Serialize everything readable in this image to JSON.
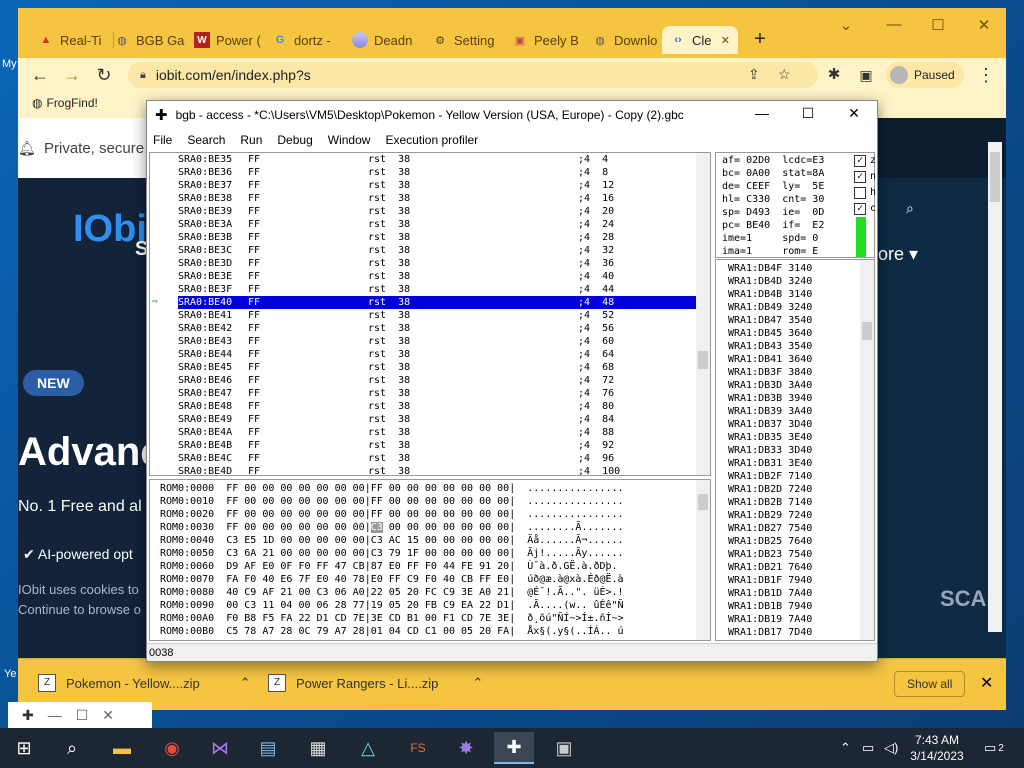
{
  "desktop": {
    "label_my": "My",
    "label_ye": "Ye"
  },
  "chrome": {
    "tabs": [
      {
        "label": "Real-Ti",
        "icon": "warning-icon",
        "color": "#d9302a"
      },
      {
        "label": "BGB Ga",
        "icon": "globe-icon",
        "color": "#555555"
      },
      {
        "label": "Power (",
        "icon": "w-logo-icon",
        "color": "#b52020"
      },
      {
        "label": "dortz -",
        "icon": "google-icon",
        "color": "#4285f4"
      },
      {
        "label": "Deadn",
        "icon": "stripes-icon",
        "color": "#8a8ad8"
      },
      {
        "label": "Setting",
        "icon": "gear-icon",
        "color": "#222222"
      },
      {
        "label": "Peely B",
        "icon": "image-icon",
        "color": "#c44"
      },
      {
        "label": "Downlo",
        "icon": "globe-icon",
        "color": "#555555"
      },
      {
        "label": "Cle",
        "icon": "code-icon",
        "color": "#1a6ed8"
      }
    ],
    "url": "iobit.com/en/index.php?s",
    "profile_label": "Paused",
    "bookmark": "FrogFind!"
  },
  "page": {
    "notif_text": "Private, secure",
    "brand": "IObi",
    "brand_s": "S",
    "new_badge": "NEW",
    "headline": "Advance",
    "sub": "No. 1 Free and al",
    "ai": "AI-powered opt",
    "cookie1": "IObit uses cookies to",
    "cookie2": "Continue to browse o",
    "store": "tore",
    "scan": "SCAN"
  },
  "downloads": {
    "items": [
      "Pokemon - Yellow....zip",
      "Power Rangers - Li....zip"
    ],
    "show_all": "Show all"
  },
  "bgb": {
    "title": "bgb - access - *C:\\Users\\VM5\\Desktop\\Pokemon - Yellow Version (USA, Europe) - Copy (2).gbc",
    "menu": [
      "File",
      "Search",
      "Run",
      "Debug",
      "Window",
      "Execution profiler"
    ],
    "disasm": [
      {
        "addr": "SRA0:BE35",
        "b": "FF",
        "op": "rst  38",
        "c": ";4  4"
      },
      {
        "addr": "SRA0:BE36",
        "b": "FF",
        "op": "rst  38",
        "c": ";4  8"
      },
      {
        "addr": "SRA0:BE37",
        "b": "FF",
        "op": "rst  38",
        "c": ";4  12"
      },
      {
        "addr": "SRA0:BE38",
        "b": "FF",
        "op": "rst  38",
        "c": ";4  16"
      },
      {
        "addr": "SRA0:BE39",
        "b": "FF",
        "op": "rst  38",
        "c": ";4  20"
      },
      {
        "addr": "SRA0:BE3A",
        "b": "FF",
        "op": "rst  38",
        "c": ";4  24"
      },
      {
        "addr": "SRA0:BE3B",
        "b": "FF",
        "op": "rst  38",
        "c": ";4  28"
      },
      {
        "addr": "SRA0:BE3C",
        "b": "FF",
        "op": "rst  38",
        "c": ";4  32"
      },
      {
        "addr": "SRA0:BE3D",
        "b": "FF",
        "op": "rst  38",
        "c": ";4  36"
      },
      {
        "addr": "SRA0:BE3E",
        "b": "FF",
        "op": "rst  38",
        "c": ";4  40"
      },
      {
        "addr": "SRA0:BE3F",
        "b": "FF",
        "op": "rst  38",
        "c": ";4  44"
      },
      {
        "addr": "SRA0:BE40",
        "b": "FF",
        "op": "rst  38",
        "c": ";4  48",
        "sel": true
      },
      {
        "addr": "SRA0:BE41",
        "b": "FF",
        "op": "rst  38",
        "c": ";4  52"
      },
      {
        "addr": "SRA0:BE42",
        "b": "FF",
        "op": "rst  38",
        "c": ";4  56"
      },
      {
        "addr": "SRA0:BE43",
        "b": "FF",
        "op": "rst  38",
        "c": ";4  60"
      },
      {
        "addr": "SRA0:BE44",
        "b": "FF",
        "op": "rst  38",
        "c": ";4  64"
      },
      {
        "addr": "SRA0:BE45",
        "b": "FF",
        "op": "rst  38",
        "c": ";4  68"
      },
      {
        "addr": "SRA0:BE46",
        "b": "FF",
        "op": "rst  38",
        "c": ";4  72"
      },
      {
        "addr": "SRA0:BE47",
        "b": "FF",
        "op": "rst  38",
        "c": ";4  76"
      },
      {
        "addr": "SRA0:BE48",
        "b": "FF",
        "op": "rst  38",
        "c": ";4  80"
      },
      {
        "addr": "SRA0:BE49",
        "b": "FF",
        "op": "rst  38",
        "c": ";4  84"
      },
      {
        "addr": "SRA0:BE4A",
        "b": "FF",
        "op": "rst  38",
        "c": ";4  88"
      },
      {
        "addr": "SRA0:BE4B",
        "b": "FF",
        "op": "rst  38",
        "c": ";4  92"
      },
      {
        "addr": "SRA0:BE4C",
        "b": "FF",
        "op": "rst  38",
        "c": ";4  96"
      },
      {
        "addr": "SRA0:BE4D",
        "b": "FF",
        "op": "rst  38",
        "c": ";4  100"
      }
    ],
    "regs": [
      "af= 02D0  lcdc=E3",
      "bc= 0A00  stat=8A",
      "de= CEEF  ly=  5E",
      "hl= C330  cnt= 30",
      "sp= D493  ie=  0D",
      "pc= BE40  if=  E2",
      "ime=1     spd= 0",
      "ima=1     rom= E"
    ],
    "flags": [
      {
        "label": "z",
        "checked": true
      },
      {
        "label": "n",
        "checked": true
      },
      {
        "label": "h",
        "checked": false
      },
      {
        "label": "c",
        "checked": true
      }
    ],
    "stack": [
      "WRA1:DB4F 3140",
      "WRA1:DB4D 3240",
      "WRA1:DB4B 3140",
      "WRA1:DB49 3240",
      "WRA1:DB47 3540",
      "WRA1:DB45 3640",
      "WRA1:DB43 3540",
      "WRA1:DB41 3640",
      "WRA1:DB3F 3840",
      "WRA1:DB3D 3A40",
      "WRA1:DB3B 3940",
      "WRA1:DB39 3A40",
      "WRA1:DB37 3D40",
      "WRA1:DB35 3E40",
      "WRA1:DB33 3D40",
      "WRA1:DB31 3E40",
      "WRA1:DB2F 7140",
      "WRA1:DB2D 7240",
      "WRA1:DB2B 7140",
      "WRA1:DB29 7240",
      "WRA1:DB27 7540",
      "WRA1:DB25 7640",
      "WRA1:DB23 7540",
      "WRA1:DB21 7640",
      "WRA1:DB1F 7940",
      "WRA1:DB1D 7A40",
      "WRA1:DB1B 7940",
      "WRA1:DB19 7A40",
      "WRA1:DB17 7D40"
    ],
    "hex": [
      "ROM0:0000  FF 00 00 00 00 00 00 00|FF 00 00 00 00 00 00 00|  ................",
      "ROM0:0010  FF 00 00 00 00 00 00 00|FF 00 00 00 00 00 00 00|  ................",
      "ROM0:0020  FF 00 00 00 00 00 00 00|FF 00 00 00 00 00 00 00|  ................",
      "ROM0:0030  FF 00 00 00 00 00 00 00|C3 00 00 00 00 00 00 00|  ........Ã.......",
      "ROM0:0040  C3 E5 1D 00 00 00 00 00|C3 AC 15 00 00 00 00 00|  Ãå......Ã¬......",
      "ROM0:0050  C3 6A 21 00 00 00 00 00|C3 79 1F 00 00 00 00 00|  Ãj!.....Ãy......",
      "ROM0:0060  D9 AF E0 0F F0 FF 47 CB|87 E0 FF F0 44 FE 91 20|  Ù¯à.ð.GË.à.ðDþ. ",
      "ROM0:0070  FA F0 40 E6 7F E0 40 78|E0 FF C9 F0 40 CB FF E0|  úð@æ.à@xà.Éð@Ë.à",
      "ROM0:0080  40 C9 AF 21 00 C3 06 A0|22 05 20 FC C9 3E A0 21|  @É¯!.Ã..\". üÉ>.!",
      "ROM0:0090  00 C3 11 04 00 06 28 77|19 05 20 FB C9 EA 22 D1|  .Ã....(w.. ûÉê\"Ñ",
      "ROM0:00A0  F0 B8 F5 FA 22 D1 CD 7E|3E CD B1 00 F1 CD 7E 3E|  ð¸õú\"ÑÍ~>Í±.ñÍ~>",
      "ROM0:00B0  C5 78 A7 28 0C 79 A7 28|01 04 CD C1 00 05 20 FA|  Åx§(.y§(..ÍÁ.. ú"
    ],
    "hex_sel_cell": "C3",
    "status": "0038"
  },
  "taskbar": {
    "time": "7:43 AM",
    "date": "3/14/2023",
    "notif_count": "2"
  }
}
